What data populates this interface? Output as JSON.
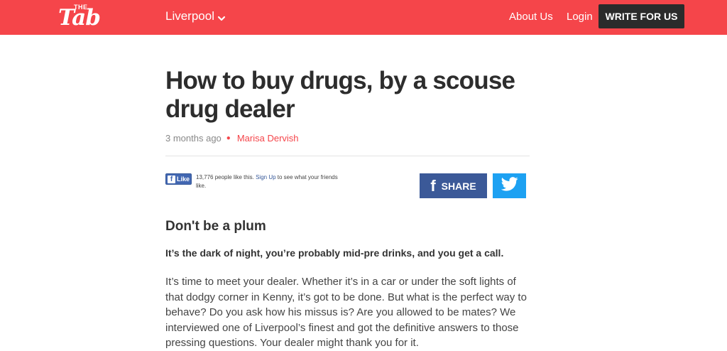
{
  "header": {
    "logo_the": "THE",
    "logo_tab": "Tab",
    "edition": "Liverpool",
    "nav": {
      "about": "About Us",
      "login": "Login",
      "write": "WRITE FOR US"
    },
    "colors": {
      "brand": "#f5454a",
      "write_button": "#2b2b2b"
    }
  },
  "article": {
    "headline": "How to buy drugs, by a scouse drug dealer",
    "time": "3 months ago",
    "author": "Marisa Dervish",
    "social": {
      "like_label": "Like",
      "like_count_text": "13,776 people like this.",
      "signup_label": "Sign Up",
      "signup_suffix": "to see what your friends like.",
      "share_label": "SHARE",
      "share_icon": "facebook-f-icon",
      "twitter_icon": "twitter-bird-icon"
    },
    "subhead": "Don't be a plum",
    "lead": "It’s the dark of night, you’re probably mid-pre drinks, and you get a call.",
    "body": "It’s time to meet your dealer. Whether it’s in a car or under the soft lights of that dodgy corner in Kenny, it’s got to be done. But what is the perfect way to behave? Do you ask how his missus is? Are you allowed to be mates? We interviewed one of Liverpool’s finest and got the definitive answers to those pressing questions. Your dealer might thank you for it."
  }
}
